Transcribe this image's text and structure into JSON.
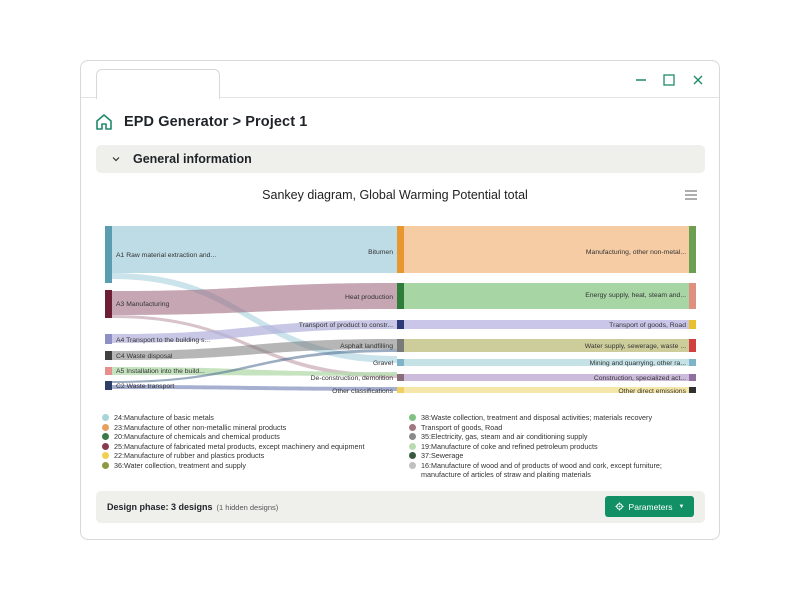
{
  "header": {
    "title": "EPD Generator > Project 1"
  },
  "section": {
    "label": "General information"
  },
  "chart": {
    "title": "Sankey diagram, Global Warming Potential total",
    "left_nodes": [
      {
        "label": "A1 Raw material extraction and...",
        "color": "#5a9cb0"
      },
      {
        "label": "A3 Manufacturing",
        "color": "#6e1f35"
      },
      {
        "label": "A4 Transport to the building s...",
        "color": "#8e8fc4"
      },
      {
        "label": "C4 Waste disposal",
        "color": "#404040"
      },
      {
        "label": "A5 Installation into the build...",
        "color": "#e68f8f"
      },
      {
        "label": "C2 Waste transport",
        "color": "#2e3f66"
      }
    ],
    "middle_nodes": [
      {
        "label": "Bitumen",
        "color": "#e8962f"
      },
      {
        "label": "Heat production",
        "color": "#2e7d3a"
      },
      {
        "label": "Transport of product to constr...",
        "color": "#2d3a7a"
      },
      {
        "label": "Asphalt landfilling",
        "color": "#7a7a7a"
      },
      {
        "label": "Gravel",
        "color": "#7fb3c9"
      },
      {
        "label": "De-construction, demolition",
        "color": "#8a6d7a"
      },
      {
        "label": "Other classifications",
        "color": "#f0d060"
      }
    ],
    "right_nodes": [
      {
        "label": "Manufacturing, other non-metal...",
        "color": "#6aa050"
      },
      {
        "label": "Energy supply, heat, steam and...",
        "color": "#e09080"
      },
      {
        "label": "Transport of goods, Road",
        "color": "#e8c030"
      },
      {
        "label": "Water supply, sewerage, waste ...",
        "color": "#d04040"
      },
      {
        "label": "Mining and quarrying, other ra...",
        "color": "#7fb3c9"
      },
      {
        "label": "Construction, specialized act...",
        "color": "#9070a0"
      },
      {
        "label": "Other direct emissions",
        "color": "#303030"
      }
    ]
  },
  "legend": {
    "left": [
      {
        "label": "24:Manufacture of basic metals",
        "color": "#a9d4d8"
      },
      {
        "label": "23:Manufacture of other non-metallic mineral products",
        "color": "#e8a060"
      },
      {
        "label": "20:Manufacture of chemicals and chemical products",
        "color": "#3a7a48"
      },
      {
        "label": "25:Manufacture of fabricated metal products, except machinery and equipment",
        "color": "#8a3a50"
      },
      {
        "label": "22:Manufacture of rubber and plastics products",
        "color": "#f0d050"
      },
      {
        "label": "36:Water collection, treatment and supply",
        "color": "#8a9a40"
      }
    ],
    "right": [
      {
        "label": "38:Waste collection, treatment and disposal activities; materials recovery",
        "color": "#80c080"
      },
      {
        "label": "Transport of goods, Road",
        "color": "#a07880"
      },
      {
        "label": "35:Electricity, gas, steam and air conditioning supply",
        "color": "#8a8a8a"
      },
      {
        "label": "19:Manufacture of coke and refined petroleum products",
        "color": "#b8dcb0"
      },
      {
        "label": "37:Sewerage",
        "color": "#3a5a40"
      },
      {
        "label": "16:Manufacture of wood and of products of wood and cork, except furniture; manufacture of articles of straw and plaiting materials",
        "color": "#c0c0c0"
      }
    ]
  },
  "footer": {
    "phase_label": "Design phase: 3 designs",
    "hidden_note": "(1 hidden designs)",
    "button_label": "Parameters"
  }
}
